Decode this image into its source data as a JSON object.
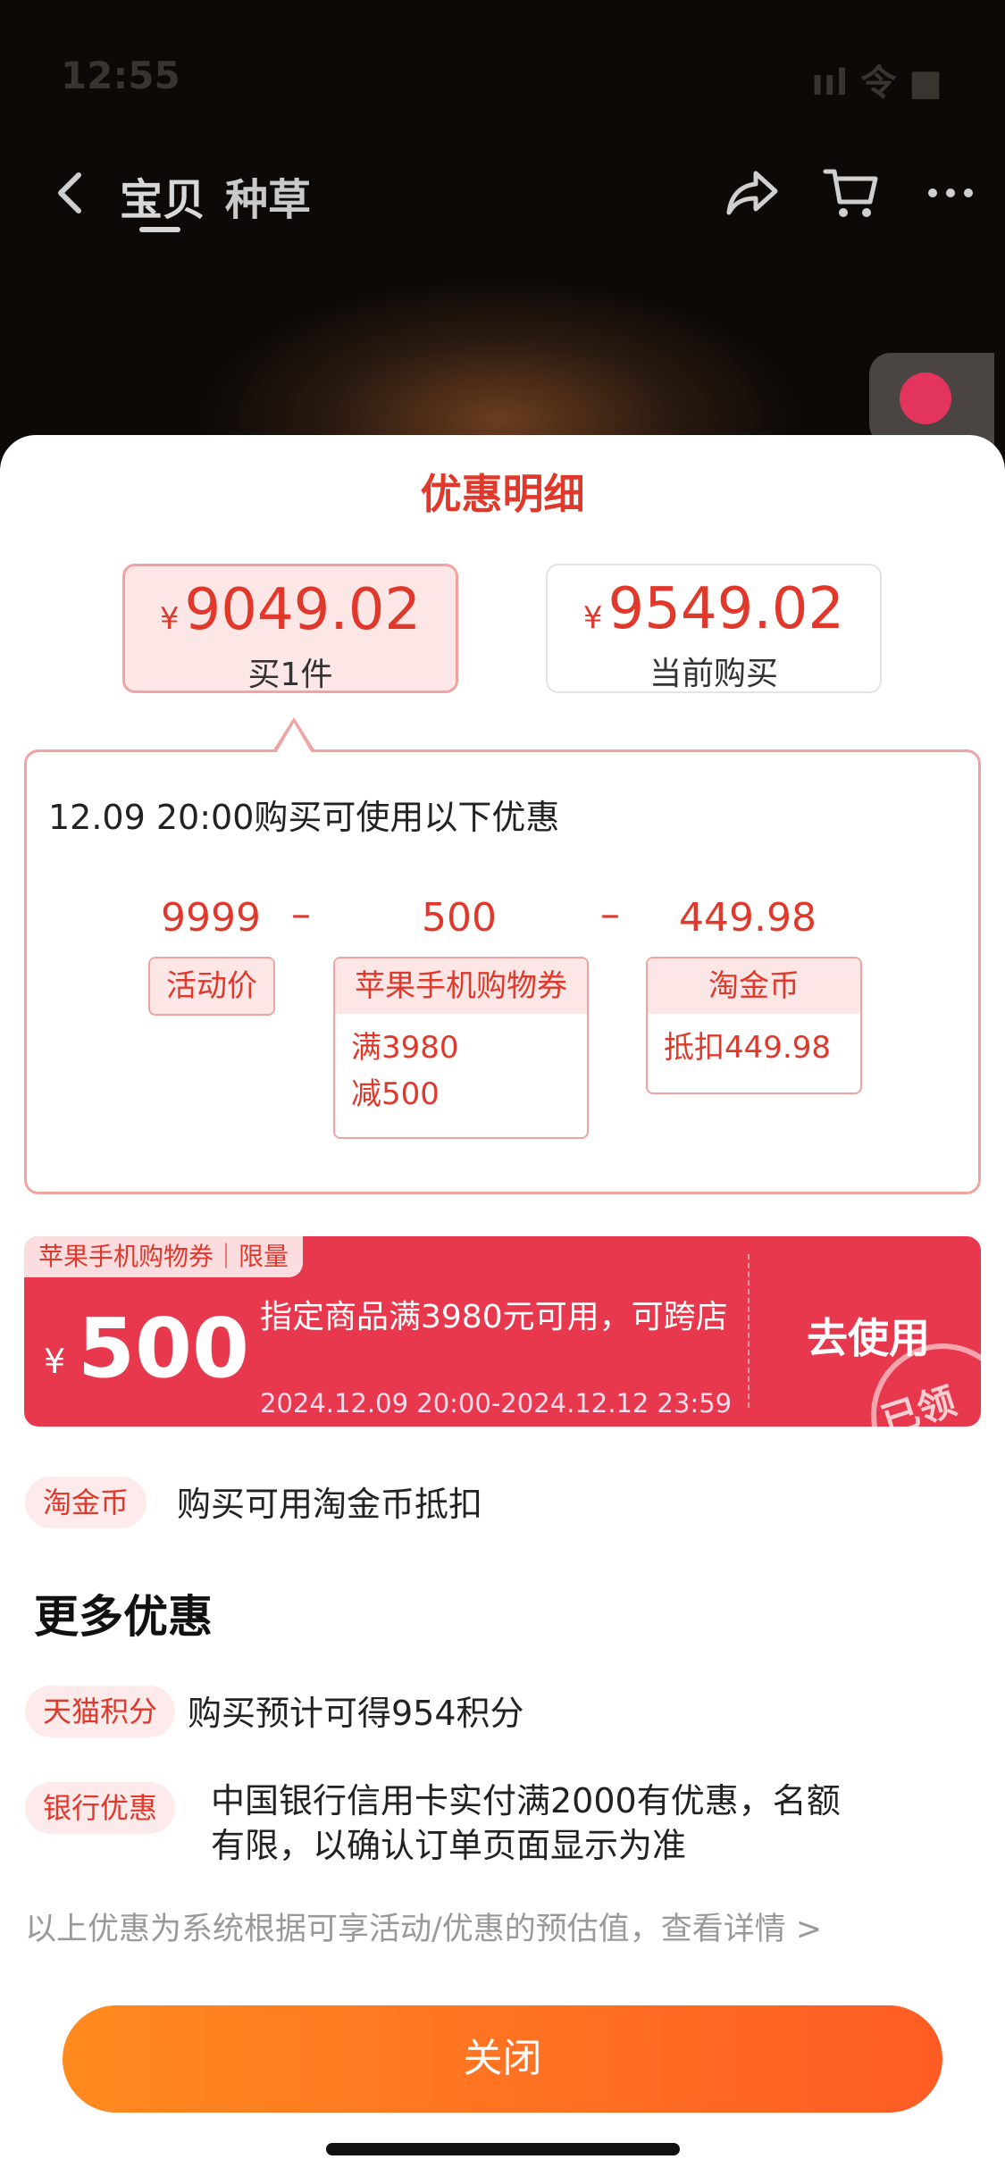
{
  "status": {
    "time": "12:55",
    "right": "ııl 令 ■"
  },
  "nav": {
    "tabs": [
      "宝贝",
      "种草"
    ]
  },
  "sheet": {
    "title": "优惠明细",
    "price_cards": [
      {
        "currency": "¥",
        "price": "9049.02",
        "label": "买1件",
        "selected": true
      },
      {
        "currency": "¥",
        "price": "9549.02",
        "label": "当前购买",
        "selected": false
      }
    ],
    "detail": {
      "heading": "12.09 20:00购买可使用以下优惠",
      "calc": {
        "a": "9999",
        "op1": "–",
        "b": "500",
        "op2": "–",
        "c": "449.98"
      },
      "tags": [
        {
          "title": "活动价",
          "lines": []
        },
        {
          "title": "苹果手机购物券",
          "lines": [
            "满3980",
            "减500"
          ]
        },
        {
          "title": "淘金币",
          "lines": [
            "抵扣449.98"
          ]
        }
      ]
    },
    "coupon": {
      "tag": "苹果手机购物券｜限量",
      "currency": "¥",
      "amount": "500",
      "desc": "指定商品满3980元可用，可跨店",
      "time": "2024.12.09 20:00-2024.12.12 23:59",
      "action": "去使用",
      "stamp": "已领"
    },
    "taojinbi": {
      "pill": "淘金币",
      "text": "购买可用淘金币抵扣"
    },
    "more_title": "更多优惠",
    "tmall": {
      "pill": "天猫积分",
      "text": "购买预计可得954积分"
    },
    "bank": {
      "pill": "银行优惠",
      "text_line1": "中国银行信用卡实付满2000有优惠，名额",
      "text_line2": "有限，以确认订单页面显示为准"
    },
    "footnote": "以上优惠为系统根据可享活动/优惠的预估值，查看详情 >",
    "close_label": "关闭"
  }
}
